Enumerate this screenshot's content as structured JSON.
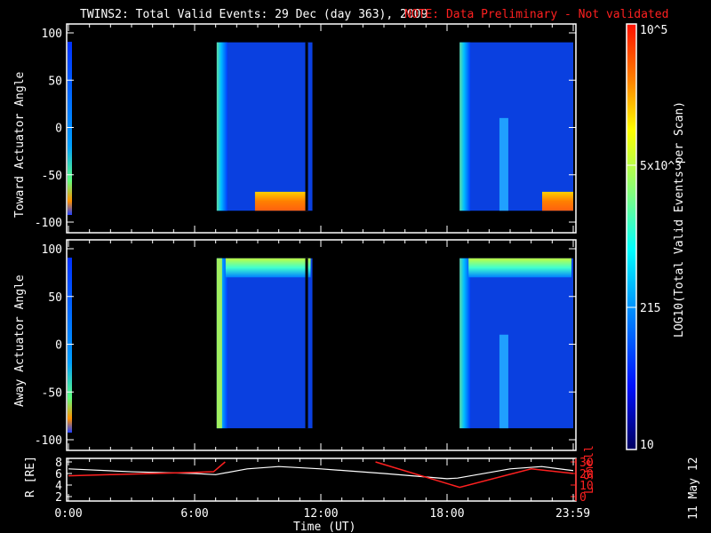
{
  "title": "TWINS2: Total Valid Events: 29 Dec (day 363), 2009",
  "note": "NOTE: Data Preliminary - Not validated",
  "date_stamp": "11 May 12",
  "colors": {
    "note": "#ff2020",
    "axis": "#ffffff",
    "lshell": "#ff2020"
  },
  "chart_data": [
    {
      "type": "heatmap",
      "name": "toward",
      "ylabel": "Toward Actuator Angle",
      "ylim": [
        -100,
        100
      ],
      "yticks": [
        "100",
        "50",
        "0",
        "-50",
        "-100"
      ],
      "ytick_values": [
        100,
        50,
        0,
        -50,
        -100
      ],
      "xlim_hours": [
        0,
        24
      ],
      "data_intervals_hours": [
        [
          7.05,
          11.6
        ],
        [
          18.6,
          24
        ]
      ],
      "angle_range": [
        -88,
        90
      ]
    },
    {
      "type": "heatmap",
      "name": "away",
      "ylabel": "Away Actuator Angle",
      "ylim": [
        -100,
        100
      ],
      "yticks": [
        "100",
        "50",
        "0",
        "-50",
        "-100"
      ],
      "ytick_values": [
        100,
        50,
        0,
        -50,
        -100
      ],
      "xlim_hours": [
        0,
        24
      ],
      "data_intervals_hours": [
        [
          7.05,
          11.6
        ],
        [
          18.6,
          24
        ]
      ],
      "angle_range": [
        -88,
        90
      ]
    },
    {
      "type": "line",
      "name": "orbit",
      "ylabel": "R [RE]",
      "ylabel_right": "L Shell",
      "ylim": [
        2,
        8
      ],
      "yticks": [
        "8",
        "6",
        "4",
        "2"
      ],
      "ytick_values": [
        8,
        6,
        4,
        2
      ],
      "ylim_right": [
        0,
        30
      ],
      "yticks_right": [
        "30",
        "20",
        "10",
        "0"
      ],
      "ytick_values_right": [
        30,
        20,
        10,
        0
      ],
      "xlabel": "Time (UT)",
      "xticks": [
        "0:00",
        "6:00",
        "12:00",
        "18:00",
        "23:59"
      ],
      "xtick_values": [
        0,
        6,
        12,
        18,
        23.98
      ],
      "series": [
        {
          "name": "R",
          "x": [
            0,
            3,
            6,
            7,
            8.5,
            10,
            12,
            15,
            18,
            18.5,
            21,
            22.5,
            24
          ],
          "y": [
            6.8,
            6.3,
            6.0,
            5.8,
            6.8,
            7.2,
            6.8,
            6.0,
            5.1,
            5.2,
            6.8,
            7.2,
            6.5
          ]
        },
        {
          "name": "L Shell",
          "segments": [
            {
              "x": [
                0,
                2,
                4,
                6,
                6.9,
                7.45
              ],
              "y": [
                18,
                19,
                20,
                21,
                21.5,
                30
              ]
            },
            {
              "x": [
                14.6,
                18.6,
                22,
                24
              ],
              "y": [
                30,
                8,
                24,
                20
              ]
            }
          ]
        }
      ]
    }
  ],
  "colorbar": {
    "label": "LOG10(Total Valid Events per Scan)",
    "ticks": [
      "10^5",
      "5x10^3",
      "215",
      "10"
    ],
    "tick_values": [
      100000,
      5000,
      215,
      10
    ]
  }
}
